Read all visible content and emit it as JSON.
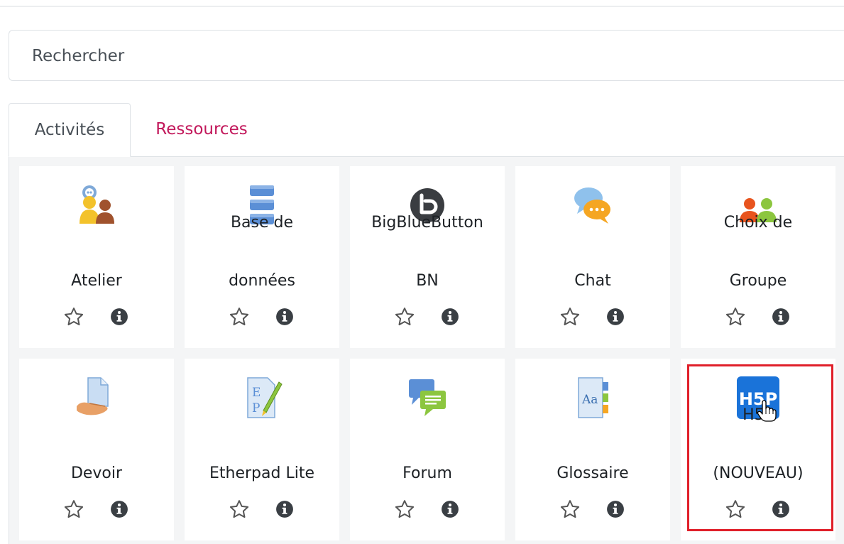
{
  "search": {
    "placeholder": "Rechercher"
  },
  "tabs": [
    {
      "label": "Activités",
      "active": true
    },
    {
      "label": "Ressources",
      "active": false
    }
  ],
  "activities": [
    {
      "name_lines": [
        "Atelier"
      ],
      "icon": "workshop-icon"
    },
    {
      "name_lines": [
        "Base de",
        "données"
      ],
      "icon": "database-icon"
    },
    {
      "name_lines": [
        "BigBlueButton",
        "BN"
      ],
      "icon": "bigbluebutton-icon"
    },
    {
      "name_lines": [
        "Chat"
      ],
      "icon": "chat-icon"
    },
    {
      "name_lines": [
        "Choix de",
        "Groupe"
      ],
      "icon": "group-choice-icon"
    },
    {
      "name_lines": [
        "Devoir"
      ],
      "icon": "assignment-icon"
    },
    {
      "name_lines": [
        "Etherpad Lite"
      ],
      "icon": "etherpad-icon"
    },
    {
      "name_lines": [
        "Forum"
      ],
      "icon": "forum-icon"
    },
    {
      "name_lines": [
        "Glossaire"
      ],
      "icon": "glossary-icon"
    },
    {
      "name_lines": [
        "H5P",
        "(NOUVEAU)"
      ],
      "icon": "h5p-icon",
      "highlighted": true
    }
  ],
  "h5p_logo_text": "H5P",
  "etherpad_logo_text": [
    "E",
    "P"
  ],
  "glossary_logo_text": "Aa",
  "colors": {
    "accent_tab": "#c2185b",
    "highlight_border": "#e0202a",
    "panel_bg": "#f4f5f6"
  }
}
